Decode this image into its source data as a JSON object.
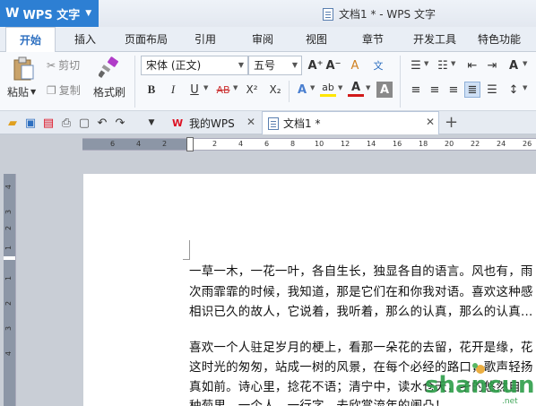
{
  "app": {
    "name": "WPS 文字",
    "logo": "W",
    "doc_title": "文档1 * - WPS 文字"
  },
  "menu": [
    "开始",
    "插入",
    "页面布局",
    "引用",
    "审阅",
    "视图",
    "章节",
    "开发工具",
    "特色功能"
  ],
  "ribbon": {
    "paste": "粘贴",
    "cut": "剪切",
    "copy": "复制",
    "format_painter": "格式刷",
    "font_name": "宋体 (正文)",
    "font_size": "五号",
    "bold": "B",
    "italic": "I",
    "underline": "U",
    "strike": "AB",
    "superscript": "X²",
    "subscript": "X₂",
    "text_effect": "A",
    "highlight": "ab",
    "font_color": "A",
    "char_shading": "A",
    "grow_font": "A⁺",
    "shrink_font": "A⁻",
    "clear_format": "A",
    "pinyin": "文"
  },
  "tabs": [
    {
      "label": "我的WPS"
    },
    {
      "label": "文档1 *"
    }
  ],
  "ruler": {
    "h_left": [
      "6",
      "4",
      "2"
    ],
    "h_right": [
      "2",
      "4",
      "6",
      "8",
      "10",
      "12",
      "14",
      "16",
      "18",
      "20",
      "22",
      "24",
      "26"
    ],
    "v": [
      "4",
      "3",
      "2",
      "1",
      "1",
      "2",
      "3",
      "4"
    ]
  },
  "document": {
    "lines": [
      "一草一木，一花一叶，各自生长，独显各自的语言。风也有，雨",
      "次雨霏霏的时候，我知道，那是它们在和你我对语。喜欢这种感",
      "相识已久的故人，它说着，我听着，那么的认真，那么的认真…",
      "",
      "喜欢一个人驻足岁月的梗上，看那一朵花的去留，花开是缘，花",
      "这时光的匆匆，站成一树的风景，在每个必经的路口，歌声轻扬",
      "真如前。诗心里，捻花不语；清宁中，读水仓天，孑的悠然自",
      "种菊里，一个人，一行字，去欣赏流年的阑凸！"
    ]
  },
  "watermark": {
    "text": "shancun",
    "sub": ".net"
  },
  "colors": {
    "accent": "#2d7fd3",
    "font_color": "#d11a1a",
    "highlight": "#ffe600"
  }
}
